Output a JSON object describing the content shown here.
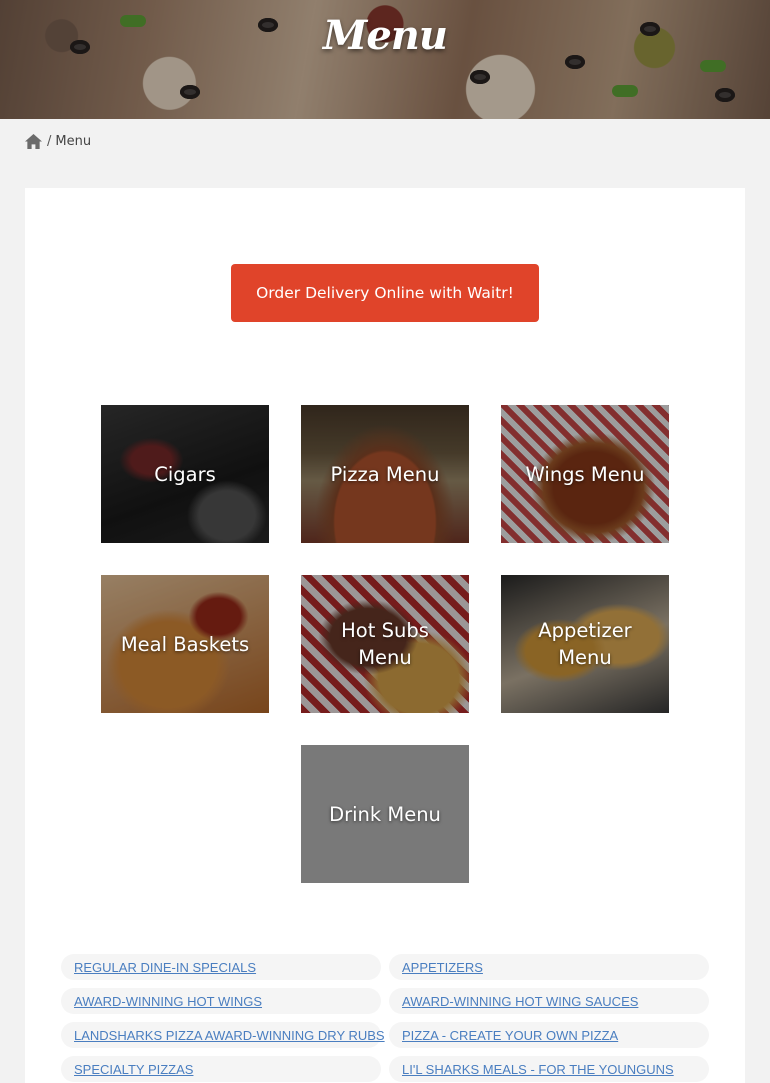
{
  "hero": {
    "title": "Menu"
  },
  "breadcrumb": {
    "separator": "/",
    "current": "Menu"
  },
  "order_button": {
    "label": "Order Delivery Online with Waitr!"
  },
  "tiles": [
    {
      "label": "Cigars"
    },
    {
      "label": "Pizza Menu"
    },
    {
      "label": "Wings Menu"
    },
    {
      "label": "Meal Baskets"
    },
    {
      "label": "Hot Subs Menu"
    },
    {
      "label": "Appetizer Menu"
    },
    {
      "label": "Drink Menu"
    }
  ],
  "links": [
    "REGULAR DINE-IN SPECIALS",
    "APPETIZERS",
    "AWARD-WINNING HOT WINGS",
    "AWARD-WINNING HOT WING SAUCES",
    "LANDSHARKS PIZZA AWARD-WINNING DRY RUBS",
    "PIZZA - CREATE YOUR OWN PIZZA",
    "SPECIALTY PIZZAS",
    "LI'L SHARKS MEALS - FOR THE YOUNGUNS"
  ],
  "colors": {
    "accent": "#e0442a",
    "link": "#4a7ec0",
    "page_bg": "#f2f2f2"
  },
  "icons": {
    "home": "home-icon"
  }
}
